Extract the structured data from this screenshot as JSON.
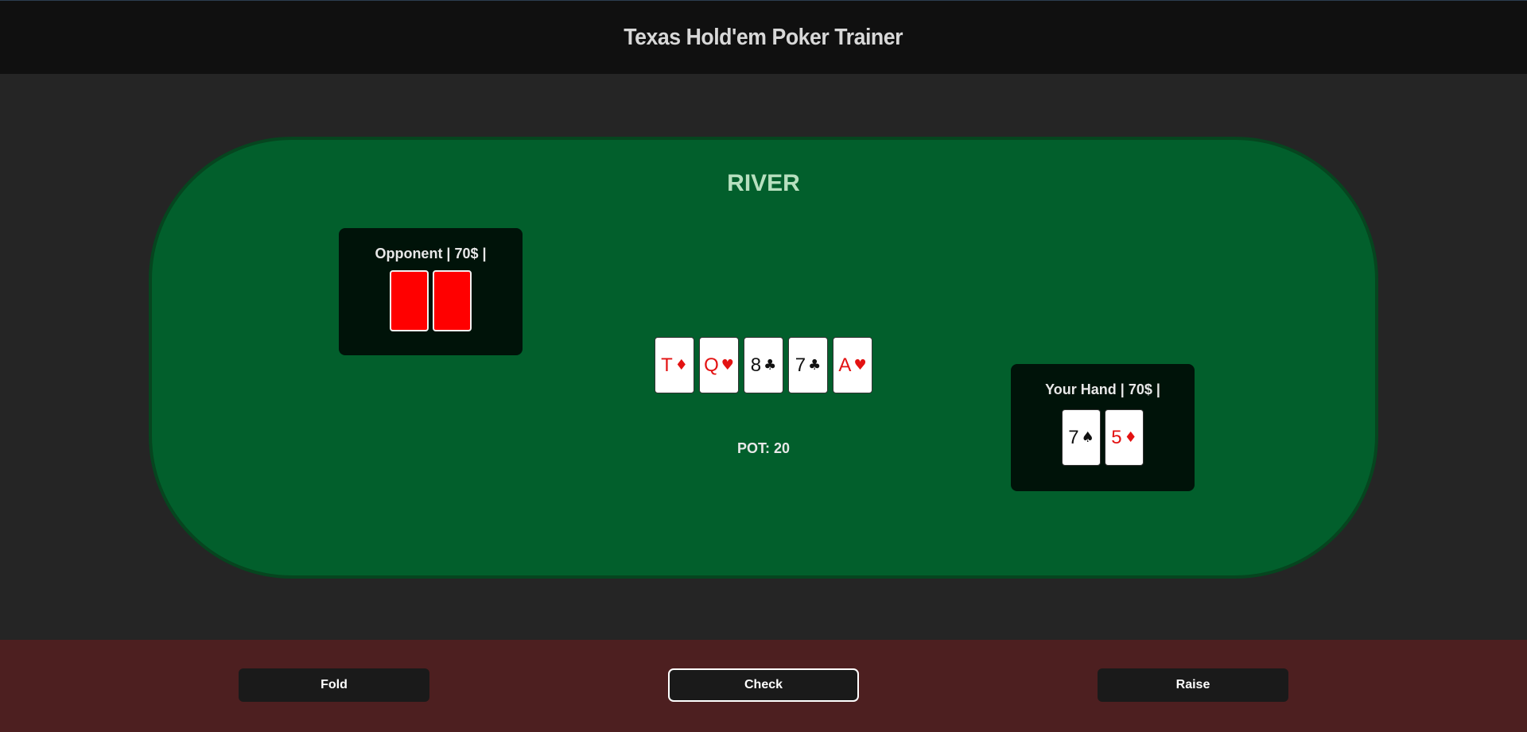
{
  "header": {
    "title": "Texas Hold'em Poker Trainer"
  },
  "table": {
    "stage": "RIVER",
    "pot_label": "POT: 20",
    "felt_color": "#025f2c"
  },
  "opponent": {
    "label": "Opponent | 70$ |",
    "cards": [
      {
        "face_down": true,
        "back_color": "#ff0000"
      },
      {
        "face_down": true,
        "back_color": "#ff0000"
      }
    ]
  },
  "board": [
    {
      "rank": "T",
      "suit": "♦",
      "suit_name": "diamonds",
      "color": "red"
    },
    {
      "rank": "Q",
      "suit": "♥",
      "suit_name": "hearts",
      "color": "red"
    },
    {
      "rank": "8",
      "suit": "♣",
      "suit_name": "clubs",
      "color": "black"
    },
    {
      "rank": "7",
      "suit": "♣",
      "suit_name": "clubs",
      "color": "black"
    },
    {
      "rank": "A",
      "suit": "♥",
      "suit_name": "hearts",
      "color": "red"
    }
  ],
  "player": {
    "label": "Your Hand | 70$ |",
    "cards": [
      {
        "rank": "7",
        "suit": "♠",
        "suit_name": "spades",
        "color": "black"
      },
      {
        "rank": "5",
        "suit": "♦",
        "suit_name": "diamonds",
        "color": "red"
      }
    ]
  },
  "actions": {
    "fold": "Fold",
    "check": "Check",
    "raise": "Raise"
  }
}
